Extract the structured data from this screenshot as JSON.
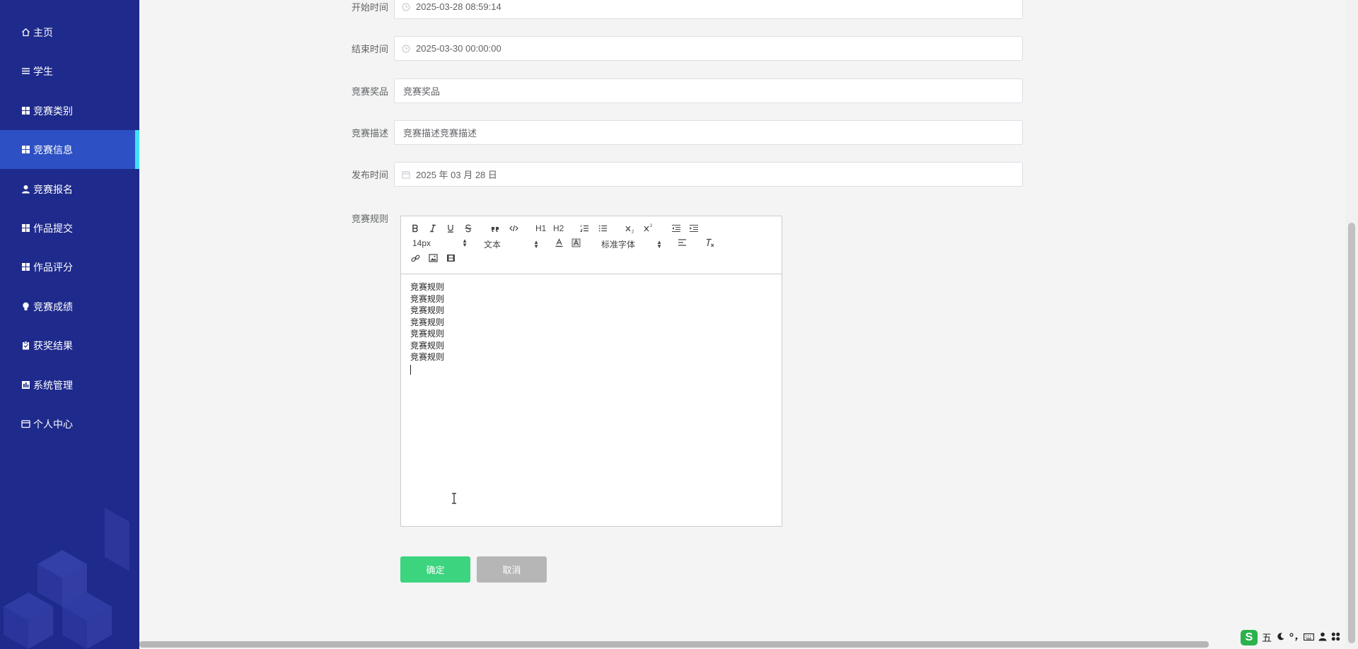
{
  "sidebar": {
    "items": [
      {
        "label": "主页",
        "icon": "home-icon"
      },
      {
        "label": "学生",
        "icon": "menu-icon"
      },
      {
        "label": "竞赛类别",
        "icon": "grid-icon"
      },
      {
        "label": "竞赛信息",
        "icon": "grid-icon",
        "active": true
      },
      {
        "label": "竞赛报名",
        "icon": "user-icon"
      },
      {
        "label": "作品提交",
        "icon": "grid-icon"
      },
      {
        "label": "作品评分",
        "icon": "grid-icon"
      },
      {
        "label": "竞赛成绩",
        "icon": "bulb-icon"
      },
      {
        "label": "获奖结果",
        "icon": "clipboard-icon"
      },
      {
        "label": "系统管理",
        "icon": "chart-icon"
      },
      {
        "label": "个人中心",
        "icon": "card-icon"
      }
    ],
    "active_color": "#2d50c4",
    "bg_color": "#1e2a8c",
    "indicator_color": "#3fe2f6"
  },
  "form": {
    "start_time": {
      "label": "开始时间",
      "value": "2025-03-28 08:59:14",
      "icon": "clock-icon"
    },
    "end_time": {
      "label": "结束时间",
      "value": "2025-03-30 00:00:00",
      "icon": "clock-icon"
    },
    "prize": {
      "label": "竞赛奖品",
      "value": "竞赛奖品"
    },
    "description": {
      "label": "竞赛描述",
      "value": "竞赛描述竞赛描述"
    },
    "publish_time": {
      "label": "发布时间",
      "value": "2025 年 03 月 28 日",
      "icon": "calendar-icon"
    },
    "rules": {
      "label": "竞赛规则",
      "lines": [
        "竞赛规则",
        "竞赛规则",
        "竞赛规则",
        "竞赛规则",
        "竞赛规则",
        "竞赛规则",
        "竞赛规则"
      ]
    }
  },
  "editor_toolbar": {
    "h1": "H1",
    "h2": "H2",
    "size": "14px",
    "header": "文本",
    "font": "标准字体"
  },
  "buttons": {
    "confirm": "确定",
    "cancel": "取消",
    "confirm_color": "#3cd47f",
    "cancel_color": "#b6b6b6"
  },
  "ime": {
    "logo": "S",
    "mode": "五"
  }
}
